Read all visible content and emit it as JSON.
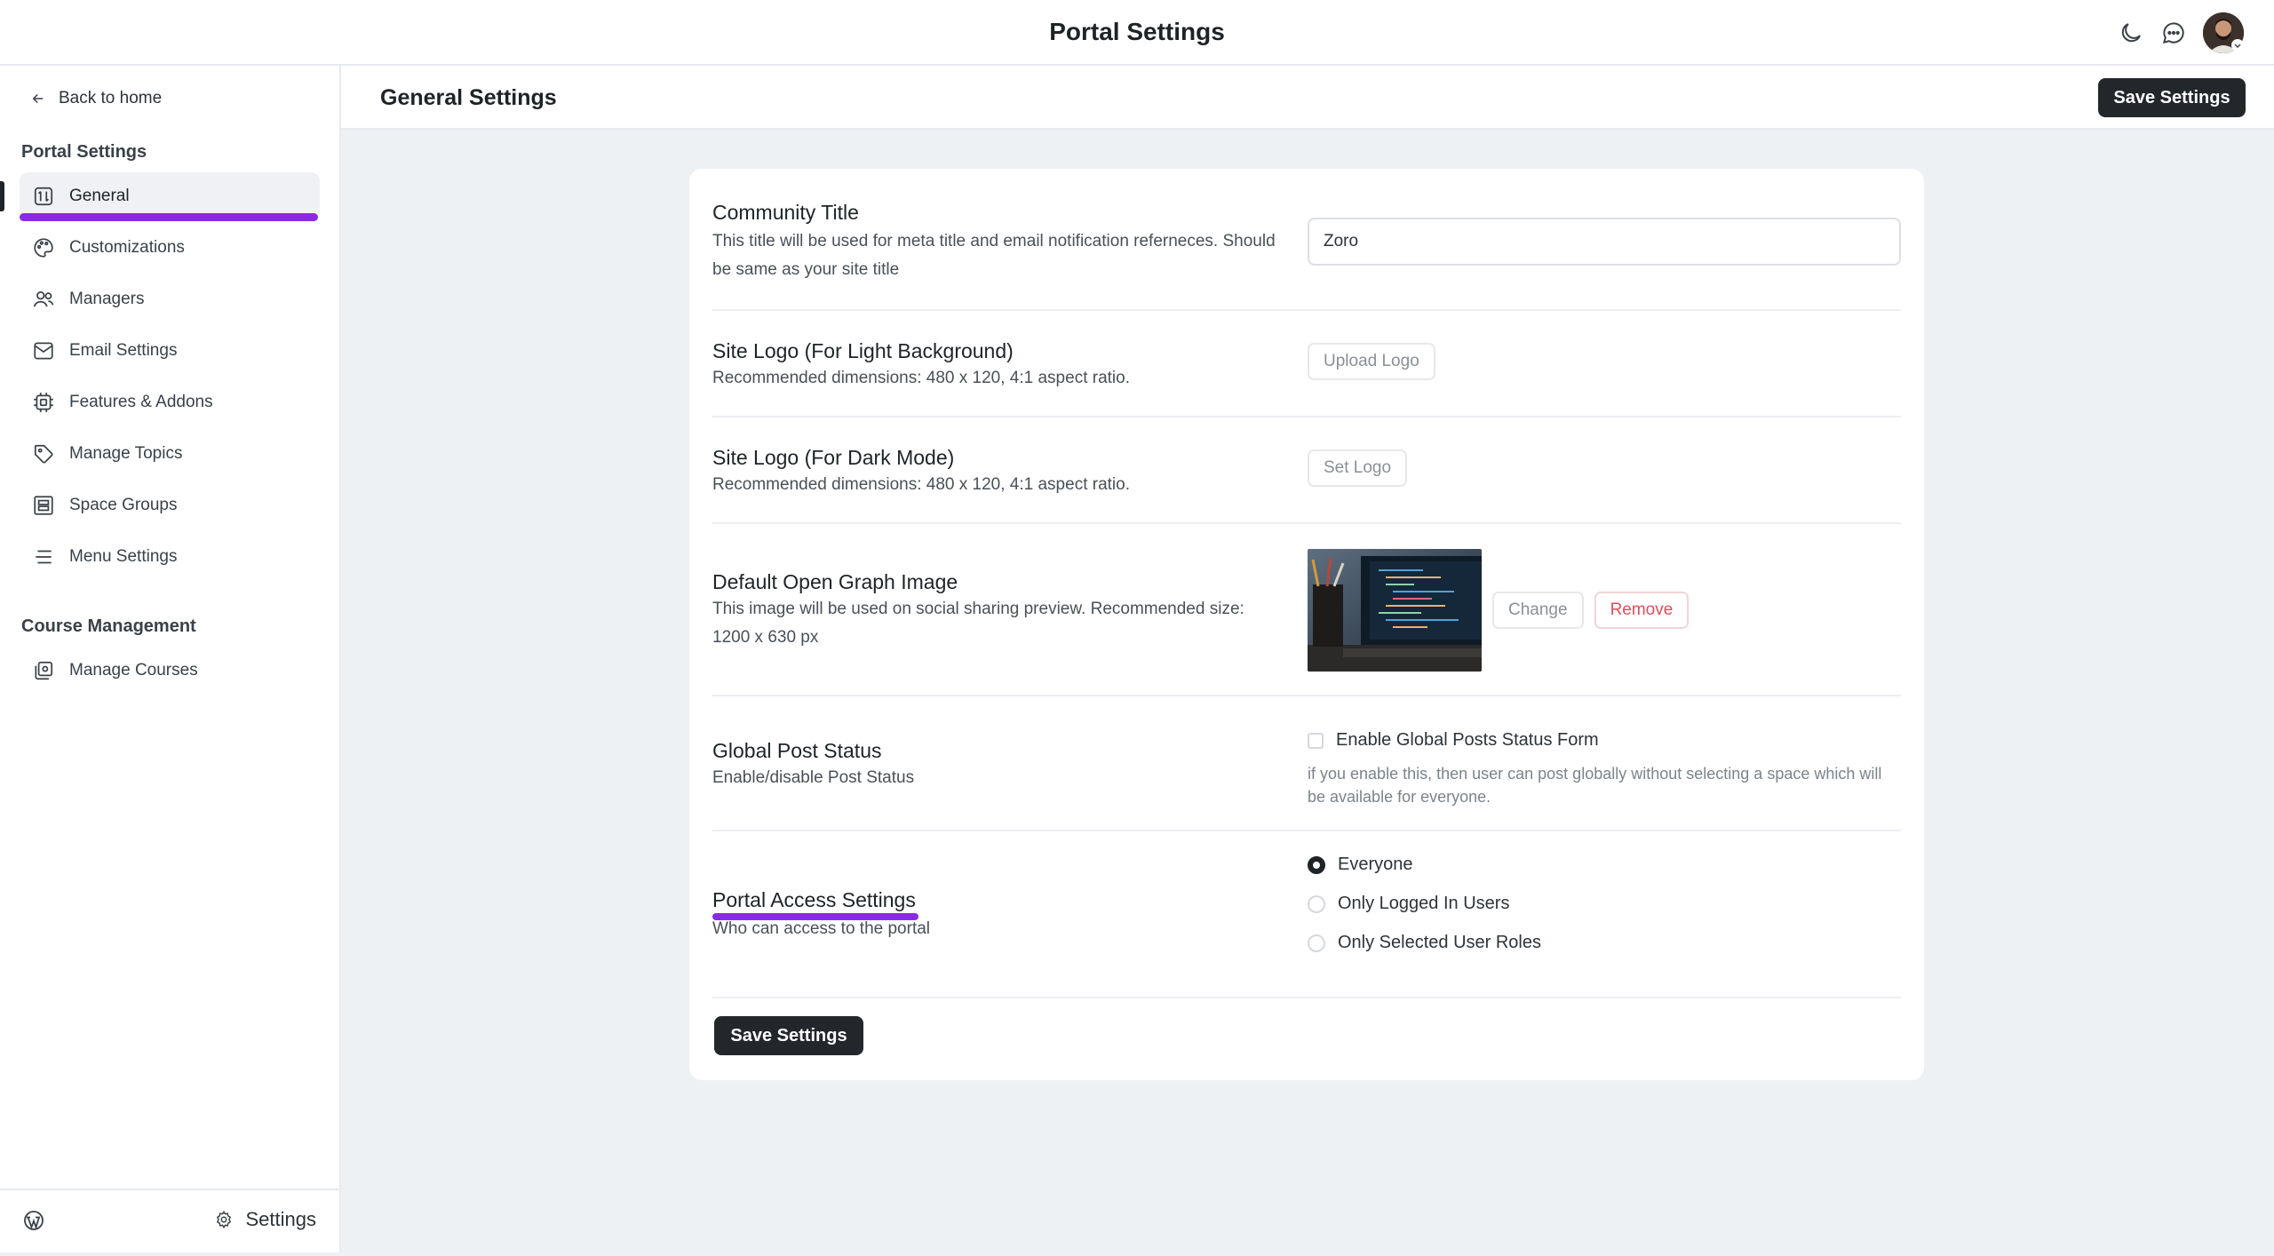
{
  "topbar": {
    "title": "Portal Settings",
    "icons": [
      "moon-icon",
      "chat-icon",
      "avatar"
    ]
  },
  "sidebar": {
    "back_label": "Back to home",
    "section_portal": "Portal Settings",
    "items": [
      {
        "label": "General",
        "icon": "general-icon",
        "active": true
      },
      {
        "label": "Customizations",
        "icon": "palette-icon"
      },
      {
        "label": "Managers",
        "icon": "users-icon"
      },
      {
        "label": "Email Settings",
        "icon": "mail-icon"
      },
      {
        "label": "Features & Addons",
        "icon": "chip-icon"
      },
      {
        "label": "Manage Topics",
        "icon": "tag-icon"
      },
      {
        "label": "Space Groups",
        "icon": "group-icon"
      },
      {
        "label": "Menu Settings",
        "icon": "menu-icon"
      }
    ],
    "section_course": "Course Management",
    "course_items": [
      {
        "label": "Manage Courses",
        "icon": "courses-icon"
      }
    ],
    "footer_settings": "Settings"
  },
  "main": {
    "heading": "General Settings",
    "save_label": "Save Settings"
  },
  "form": {
    "community_title": {
      "label": "Community Title",
      "desc": "This title will be used for meta title and email notification referneces. Should be same as your site title",
      "value": "Zoro"
    },
    "logo_light": {
      "label": "Site Logo (For Light Background)",
      "desc": "Recommended dimensions: 480 x 120, 4:1 aspect ratio.",
      "button": "Upload Logo"
    },
    "logo_dark": {
      "label": "Site Logo (For Dark Mode)",
      "desc": "Recommended dimensions: 480 x 120, 4:1 aspect ratio.",
      "button": "Set Logo"
    },
    "og_image": {
      "label": "Default Open Graph Image",
      "desc": "This image will be used on social sharing preview. Recommended size: 1200 x 630 px",
      "change": "Change",
      "remove": "Remove"
    },
    "global_post": {
      "label": "Global Post Status",
      "desc": "Enable/disable Post Status",
      "checkbox_label": "Enable Global Posts Status Form",
      "hint": "if you enable this, then user can post globally without selecting a space which will be available for everyone."
    },
    "portal_access": {
      "label": "Portal Access Settings",
      "desc": "Who can access to the portal",
      "options": [
        "Everyone",
        "Only Logged In Users",
        "Only Selected User Roles"
      ],
      "selected": "Everyone"
    },
    "save_label": "Save Settings"
  },
  "colors": {
    "accent_annotation": "#8a2be2",
    "dark_button": "#23272c",
    "remove": "#e04e5b"
  }
}
